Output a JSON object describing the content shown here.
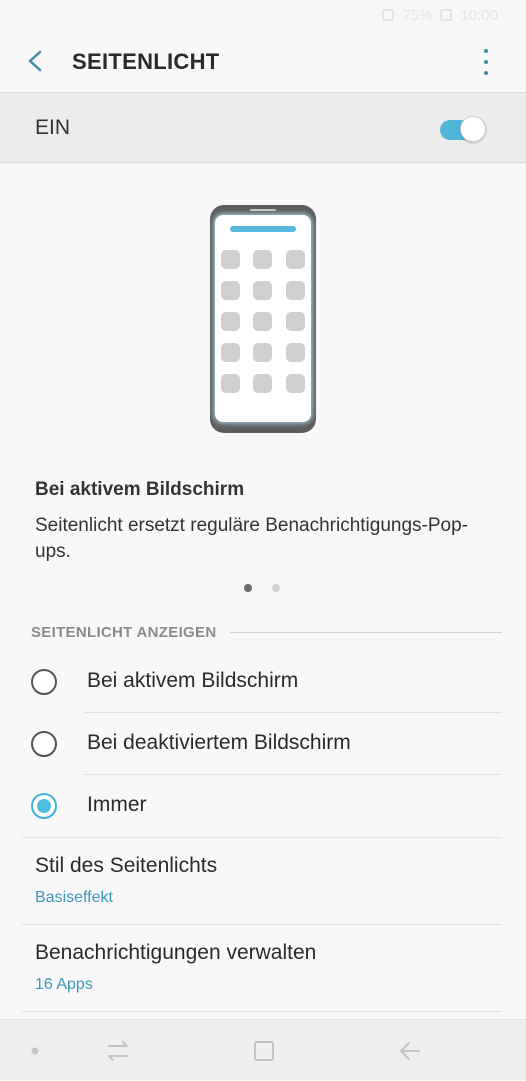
{
  "status_bar": {
    "battery": "75%",
    "time": "10:00"
  },
  "appbar": {
    "title": "SEITENLICHT"
  },
  "master_switch": {
    "label": "EIN",
    "on": true
  },
  "preview": {
    "title": "Bei aktivem Bildschirm",
    "description": "Seitenlicht ersetzt reguläre Benachrichtigungs-Pop-ups.",
    "page": 1,
    "page_count": 2
  },
  "section": {
    "header": "SEITENLICHT ANZEIGEN",
    "options": [
      {
        "label": "Bei aktivem Bildschirm",
        "selected": false
      },
      {
        "label": "Bei deaktiviertem Bildschirm",
        "selected": false
      },
      {
        "label": "Immer",
        "selected": true
      }
    ]
  },
  "settings": [
    {
      "title": "Stil des Seitenlichts",
      "value": "Basiseffekt"
    },
    {
      "title": "Benachrichtigungen verwalten",
      "value": "16 Apps"
    }
  ],
  "colors": {
    "accent": "#4fb6d9",
    "link": "#3d98b6",
    "background": "#f8f8f8"
  },
  "navbar": {
    "icons": [
      "dot-icon",
      "recent-apps-icon",
      "home-icon",
      "back-icon"
    ]
  }
}
